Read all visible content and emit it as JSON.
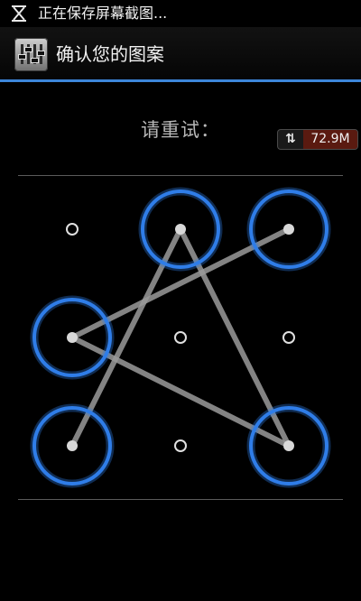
{
  "status_bar": {
    "notification_icon": "screenshot-saving-icon",
    "text": "正在保存屏幕截图..."
  },
  "title_bar": {
    "app_icon": "equalizer-sliders-icon",
    "title": "确认您的图案",
    "divider_color": "#3c86d9"
  },
  "prompt": {
    "text": "请重试："
  },
  "traffic_badge": {
    "icon": "up-down-arrows-icon",
    "arrows": "⇅",
    "value": "72.9M"
  },
  "pattern": {
    "ring_color": "#2f7de8",
    "line_color": "#9a9a9a",
    "dots": [
      {
        "id": 1,
        "selected": false
      },
      {
        "id": 2,
        "selected": true
      },
      {
        "id": 3,
        "selected": true
      },
      {
        "id": 4,
        "selected": true
      },
      {
        "id": 5,
        "selected": false
      },
      {
        "id": 6,
        "selected": false
      },
      {
        "id": 7,
        "selected": true
      },
      {
        "id": 8,
        "selected": false
      },
      {
        "id": 9,
        "selected": true
      }
    ],
    "sequence": [
      7,
      2,
      9,
      4,
      3
    ]
  }
}
